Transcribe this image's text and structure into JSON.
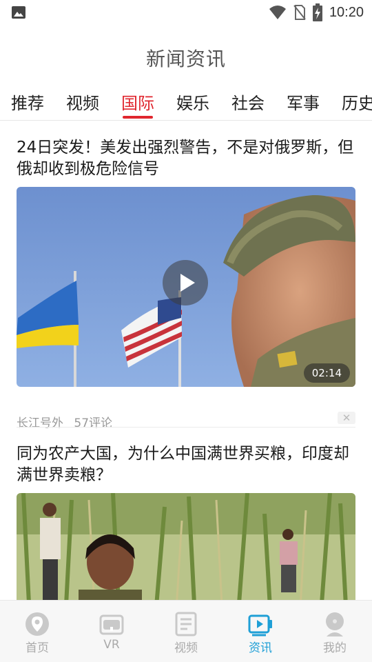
{
  "status_bar": {
    "time": "10:20",
    "icons": [
      "image-icon",
      "wifi-icon",
      "no-sim-icon",
      "battery-charging-icon"
    ]
  },
  "header": {
    "title": "新闻资讯"
  },
  "tabs": [
    {
      "label": "推荐",
      "active": false
    },
    {
      "label": "视频",
      "active": false
    },
    {
      "label": "国际",
      "active": true
    },
    {
      "label": "娱乐",
      "active": false
    },
    {
      "label": "社会",
      "active": false
    },
    {
      "label": "军事",
      "active": false
    },
    {
      "label": "历史",
      "active": false
    }
  ],
  "feed": {
    "articles": [
      {
        "title": "24日突发！美发出强烈警告，不是对俄罗斯，但俄却收到极危险信号",
        "duration": "02:14",
        "source": "长江号外",
        "comments": "57评论",
        "dismiss": "✕"
      },
      {
        "title": "同为农产大国，为什么中国满世界买粮，印度却满世界卖粮？"
      }
    ]
  },
  "bottom_nav": {
    "items": [
      {
        "label": "首页",
        "icon": "location-pin-icon",
        "active": false
      },
      {
        "label": "VR",
        "icon": "vr-headset-icon",
        "active": false
      },
      {
        "label": "视频",
        "icon": "document-icon",
        "active": false
      },
      {
        "label": "资讯",
        "icon": "video-play-icon",
        "active": true
      },
      {
        "label": "我的",
        "icon": "profile-icon",
        "active": false
      }
    ]
  },
  "colors": {
    "accent": "#e0262e",
    "nav_active": "#1f9fd6",
    "meta_text": "#999999"
  }
}
